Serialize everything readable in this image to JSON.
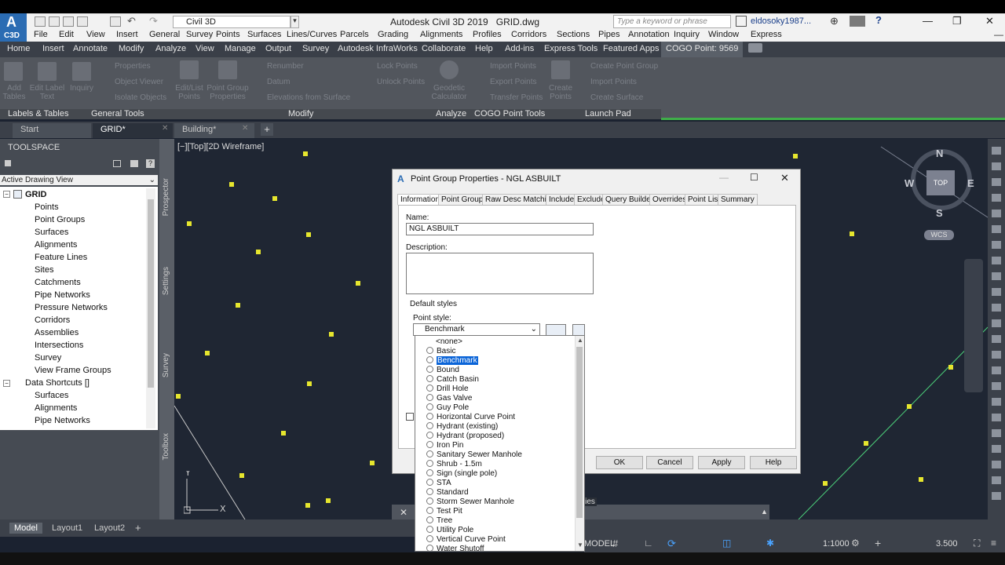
{
  "app": {
    "logo": "C3D",
    "workspace": "Civil 3D",
    "title": "Autodesk Civil 3D 2019",
    "file": "GRID.dwg",
    "search_placeholder": "Type a keyword or phrase",
    "user": "eldosoky1987..."
  },
  "menu": [
    "File",
    "Edit",
    "View",
    "Insert",
    "General",
    "Survey",
    "Points",
    "Surfaces",
    "Lines/Curves",
    "Parcels",
    "Grading",
    "Alignments",
    "Profiles",
    "Corridors",
    "Sections",
    "Pipes",
    "Annotation",
    "Inquiry",
    "Window",
    "Express"
  ],
  "ribbon_tabs": [
    "Home",
    "Insert",
    "Annotate",
    "Modify",
    "Analyze",
    "View",
    "Manage",
    "Output",
    "Survey",
    "Autodesk InfraWorks",
    "Collaborate",
    "Help",
    "Add-ins",
    "Express Tools",
    "Featured Apps",
    "COGO Point: 9569"
  ],
  "ribbon": {
    "panels": [
      "Labels & Tables",
      "General Tools",
      "Modify",
      "Analyze",
      "COGO Point Tools",
      "Launch Pad"
    ],
    "buttons": [
      "Add Tables",
      "Edit Label Text",
      "Inquiry",
      "Properties",
      "Object Viewer",
      "Isolate Objects",
      "Edit/List Points",
      "Point Group Properties",
      "Renumber",
      "Datum",
      "Elevations from Surface",
      "Lock Points",
      "Unlock Points",
      "Geodetic Calculator",
      "Import Points",
      "Export Points",
      "Transfer Points",
      "Create Points",
      "Create Point Group",
      "Import Points",
      "Create Surface"
    ]
  },
  "doc_tabs": [
    "Start",
    "GRID*",
    "Building*"
  ],
  "toolspace": {
    "title": "TOOLSPACE",
    "view": "Active Drawing View",
    "root": "GRID",
    "items": [
      "Points",
      "Point Groups",
      "Surfaces",
      "Alignments",
      "Feature Lines",
      "Sites",
      "Catchments",
      "Pipe Networks",
      "Pressure Networks",
      "Corridors",
      "Assemblies",
      "Intersections",
      "Survey",
      "View Frame Groups"
    ],
    "shortcuts": "Data Shortcuts []",
    "shortcut_items": [
      "Surfaces",
      "Alignments",
      "Pipe Networks"
    ],
    "side_tabs": [
      "Prospector",
      "Settings",
      "Survey",
      "Toolbox"
    ]
  },
  "viewport": {
    "label": "[−][Top][2D Wireframe]",
    "compass": {
      "n": "N",
      "s": "S",
      "e": "E",
      "w": "W",
      "cube": "TOP",
      "wcs": "WCS"
    }
  },
  "dialog": {
    "title": "Point Group Properties - NGL ASBUILT",
    "tabs": [
      "Information",
      "Point Groups",
      "Raw Desc Matching",
      "Include",
      "Exclude",
      "Query Builder",
      "Overrides",
      "Point List",
      "Summary"
    ],
    "name_label": "Name:",
    "name_value": "NGL ASBUILT",
    "desc_label": "Description:",
    "defaults_label": "Default styles",
    "point_style_label": "Point style:",
    "point_style_value": "Benchmark",
    "buttons": {
      "ok": "OK",
      "cancel": "Cancel",
      "apply": "Apply",
      "help": "Help"
    }
  },
  "dropdown": [
    "<none>",
    "Basic",
    "Benchmark",
    "Bound",
    "Catch Basin",
    "Drill Hole",
    "Gas Valve",
    "Guy Pole",
    "Horizontal Curve Point",
    "Hydrant (existing)",
    "Hydrant (proposed)",
    "Iron Pin",
    "Sanitary Sewer Manhole",
    "Shrub - 1.5m",
    "Sign (single pole)",
    "STA",
    "Standard",
    "Storm Sewer Manhole",
    "Test Pit",
    "Tree",
    "Utility Pole",
    "Vertical Curve Point",
    "Water Shutoff"
  ],
  "dropdown_selected": "Benchmark",
  "statusbar": {
    "tabs": [
      "Model",
      "Layout1",
      "Layout2"
    ],
    "model_label": "MODEL",
    "scale": "1:1000",
    "value": "3.500",
    "cmd_hint": "rties"
  }
}
